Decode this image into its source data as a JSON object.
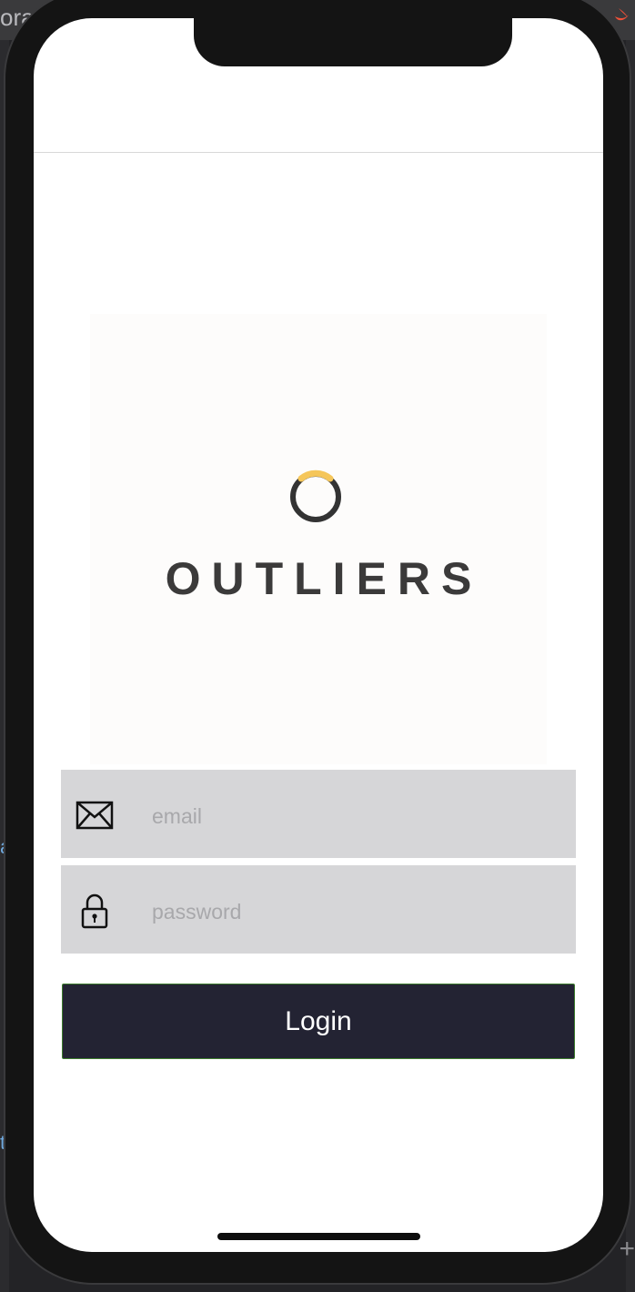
{
  "background": {
    "editor_snippet": "ora",
    "side_letter_top": "a",
    "side_letter_bottom": "t",
    "plus_glyph": "+"
  },
  "logo": {
    "wordmark": "OUTLIERS",
    "ring_colors": {
      "main": "#333333",
      "accent": "#f5c65a"
    }
  },
  "login_form": {
    "email": {
      "icon": "envelope-icon",
      "placeholder": "email",
      "value": ""
    },
    "password": {
      "icon": "lock-icon",
      "placeholder": "password",
      "value": ""
    },
    "login_button_label": "Login"
  },
  "colors": {
    "button_background": "#232333",
    "field_background": "#d6d6d8",
    "logo_panel": "#fdfcfb"
  }
}
